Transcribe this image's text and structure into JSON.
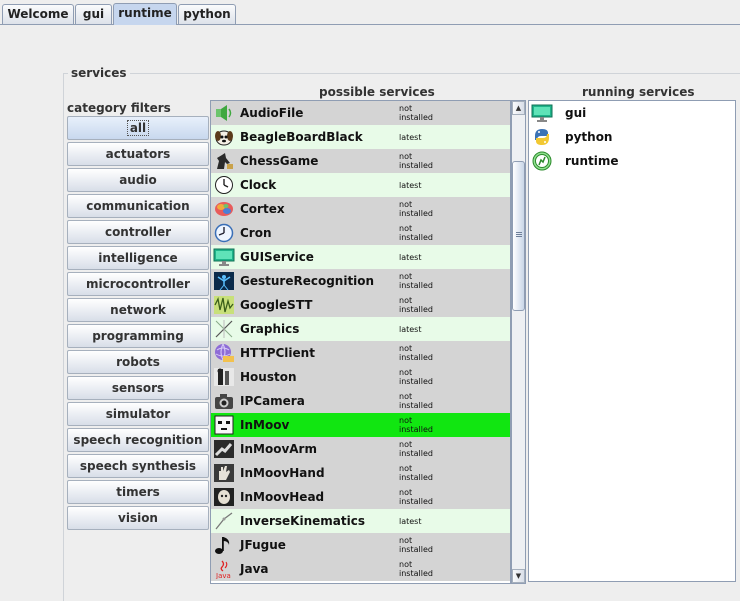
{
  "tabs": [
    {
      "label": "Welcome",
      "active": false
    },
    {
      "label": "gui",
      "active": false
    },
    {
      "label": "runtime",
      "active": true
    },
    {
      "label": "python",
      "active": false
    }
  ],
  "panel": {
    "title": "services",
    "filters_header": "category filters",
    "possible_header": "possible services",
    "running_header": "running services"
  },
  "filters": [
    "all",
    "actuators",
    "audio",
    "communication",
    "controller",
    "intelligence",
    "microcontroller",
    "network",
    "programming",
    "robots",
    "sensors",
    "simulator",
    "speech recognition",
    "speech synthesis",
    "timers",
    "vision"
  ],
  "selected_filter": "all",
  "possible_services": [
    {
      "name": "AudioFile",
      "status": "not\ninstalled",
      "icon": "speaker-icon",
      "state": "gray"
    },
    {
      "name": "BeagleBoardBlack",
      "status": "latest",
      "icon": "beagle-icon",
      "state": "light"
    },
    {
      "name": "ChessGame",
      "status": "not\ninstalled",
      "icon": "chess-icon",
      "state": "gray"
    },
    {
      "name": "Clock",
      "status": "latest",
      "icon": "clock-icon",
      "state": "light"
    },
    {
      "name": "Cortex",
      "status": "not\ninstalled",
      "icon": "brain-icon",
      "state": "gray"
    },
    {
      "name": "Cron",
      "status": "not\ninstalled",
      "icon": "cron-clock-icon",
      "state": "gray"
    },
    {
      "name": "GUIService",
      "status": "latest",
      "icon": "monitor-icon",
      "state": "light"
    },
    {
      "name": "GestureRecognition",
      "status": "not\ninstalled",
      "icon": "gesture-icon",
      "state": "gray"
    },
    {
      "name": "GoogleSTT",
      "status": "not\ninstalled",
      "icon": "waveform-icon",
      "state": "gray"
    },
    {
      "name": "Graphics",
      "status": "latest",
      "icon": "graphics-icon",
      "state": "light"
    },
    {
      "name": "HTTPClient",
      "status": "not\ninstalled",
      "icon": "globe-icon",
      "state": "gray"
    },
    {
      "name": "Houston",
      "status": "not\ninstalled",
      "icon": "houston-icon",
      "state": "gray"
    },
    {
      "name": "IPCamera",
      "status": "not\ninstalled",
      "icon": "camera-icon",
      "state": "gray"
    },
    {
      "name": "InMoov",
      "status": "not\ninstalled",
      "icon": "inmoov-face-icon",
      "state": "sel"
    },
    {
      "name": "InMoovArm",
      "status": "not\ninstalled",
      "icon": "arm-icon",
      "state": "gray"
    },
    {
      "name": "InMoovHand",
      "status": "not\ninstalled",
      "icon": "hand-icon",
      "state": "gray"
    },
    {
      "name": "InMoovHead",
      "status": "not\ninstalled",
      "icon": "head-icon",
      "state": "gray"
    },
    {
      "name": "InverseKinematics",
      "status": "latest",
      "icon": "kinematics-icon",
      "state": "light"
    },
    {
      "name": "JFugue",
      "status": "not\ninstalled",
      "icon": "music-note-icon",
      "state": "gray"
    },
    {
      "name": "Java",
      "status": "not\ninstalled",
      "icon": "java-icon",
      "state": "gray"
    }
  ],
  "running_services": [
    {
      "name": "gui",
      "icon": "monitor-icon"
    },
    {
      "name": "python",
      "icon": "python-icon"
    },
    {
      "name": "runtime",
      "icon": "runtime-icon"
    }
  ],
  "colors": {
    "selected_row": "#11e611",
    "latest_row": "#e8fbe8",
    "not_installed_row": "#d4d4d4",
    "active_tab": "#c6d6ee"
  }
}
